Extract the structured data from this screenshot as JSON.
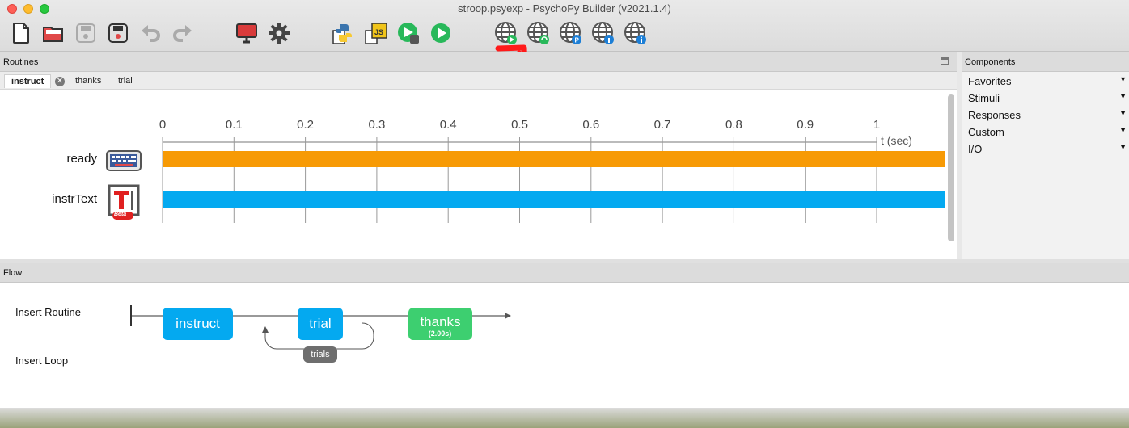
{
  "window": {
    "title": "stroop.psyexp - PsychoPy Builder (v2021.1.4)"
  },
  "toolbar": {
    "icons": [
      "new-file-icon",
      "open-folder-icon",
      "save-icon",
      "save-as-icon",
      "undo-icon",
      "redo-icon",
      "monitor-icon",
      "settings-gear-icon",
      "python-compile-icon",
      "js-compile-icon",
      "run-pilot-icon",
      "run-icon",
      "globe-pilot-icon",
      "globe-sync-icon",
      "globe-pavlovia-icon",
      "globe-user-icon",
      "globe-info-icon"
    ]
  },
  "routines": {
    "header": "Routines",
    "tabs": [
      "instruct",
      "thanks",
      "trial"
    ],
    "active_tab": "instruct",
    "ticks": [
      "0",
      "0.1",
      "0.2",
      "0.3",
      "0.4",
      "0.5",
      "0.6",
      "0.7",
      "0.8",
      "0.9",
      "1"
    ],
    "time_unit": "t (sec)",
    "components": [
      {
        "name": "ready",
        "icon": "keyboard-icon",
        "color": "#f79a05"
      },
      {
        "name": "instrText",
        "icon": "textbox-beta-icon",
        "color": "#04a9f0"
      }
    ],
    "beta_label": "Beta"
  },
  "components_panel": {
    "header": "Components",
    "categories": [
      "Favorites",
      "Stimuli",
      "Responses",
      "Custom",
      "I/O"
    ]
  },
  "flow": {
    "header": "Flow",
    "insert_routine": "Insert Routine",
    "insert_loop": "Insert Loop",
    "routines": [
      {
        "name": "instruct",
        "color": "#04a9f0",
        "sub": ""
      },
      {
        "name": "trial",
        "color": "#04a9f0",
        "sub": ""
      },
      {
        "name": "thanks",
        "color": "#3dcf70",
        "sub": "(2.00s)"
      }
    ],
    "loop_name": "trials"
  },
  "colors": {
    "accent_blue": "#04a9f0",
    "accent_orange": "#f79a05",
    "accent_green": "#3dcf70",
    "arrow_red": "#ff1a1a"
  }
}
